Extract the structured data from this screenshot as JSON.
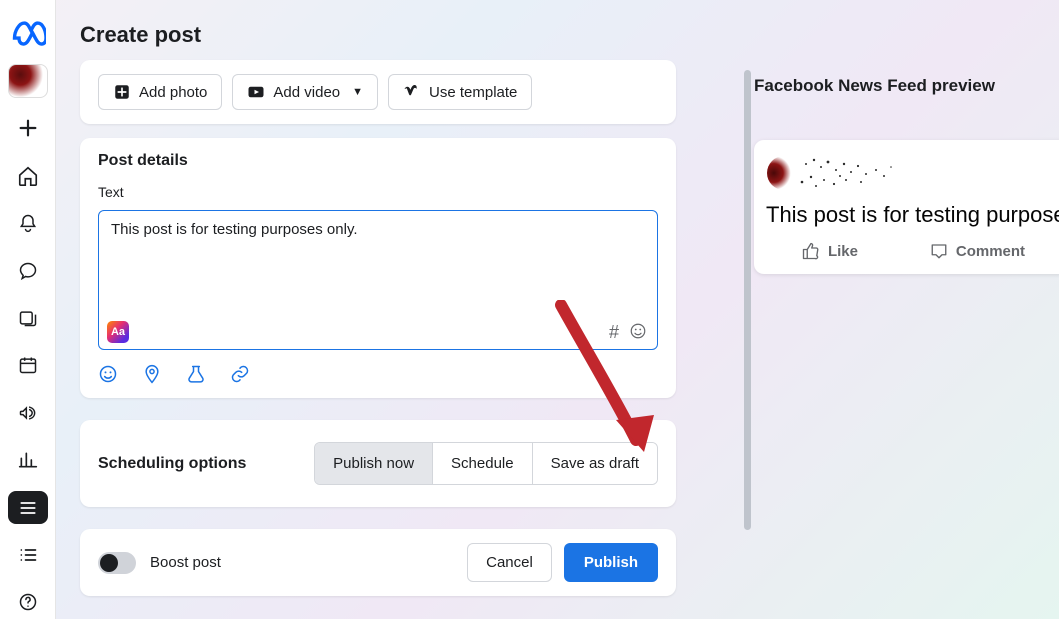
{
  "header": {
    "title": "Create post"
  },
  "media": {
    "add_photo": "Add photo",
    "add_video": "Add video",
    "use_template": "Use template"
  },
  "details": {
    "section_title": "Post details",
    "text_label": "Text",
    "text_value": "This post is for testing purposes only."
  },
  "scheduling": {
    "section_title": "Scheduling options",
    "publish_now": "Publish now",
    "schedule": "Schedule",
    "save_draft": "Save as draft"
  },
  "footer": {
    "boost_label": "Boost post",
    "cancel": "Cancel",
    "publish": "Publish"
  },
  "preview": {
    "title": "Facebook News Feed preview",
    "post_text": "This post is for testing purposes o",
    "like_label": "Like",
    "comment_label": "Comment"
  }
}
